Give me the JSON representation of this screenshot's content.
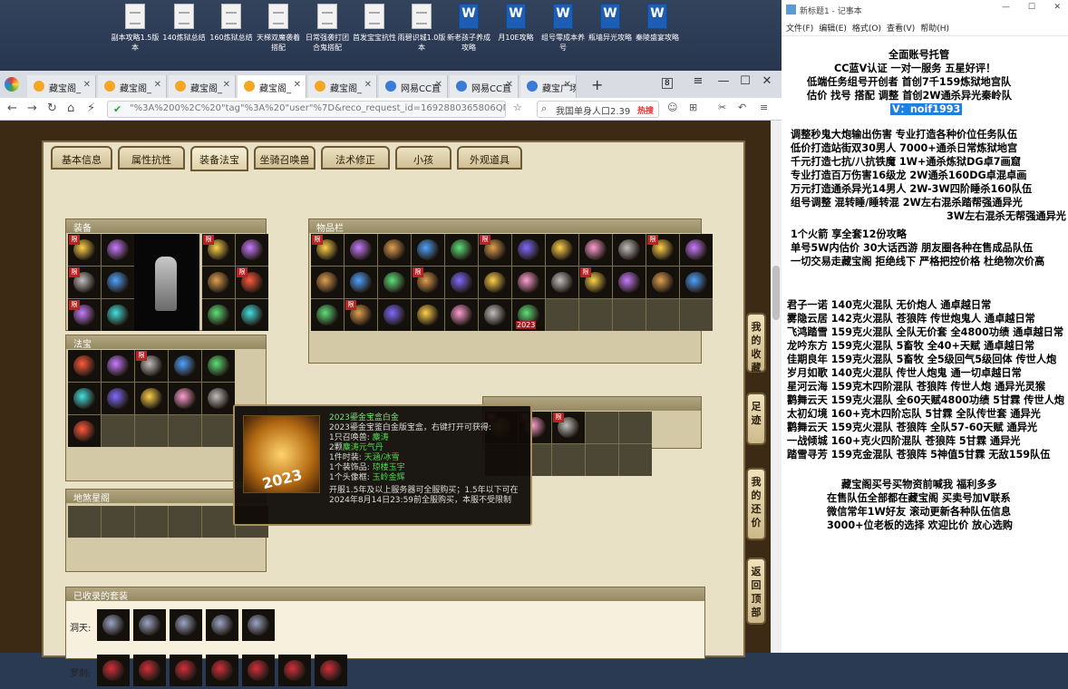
{
  "desktop": {
    "icons": [
      {
        "label": "副本攻略1.5版本",
        "type": "doc"
      },
      {
        "label": "140炼狱总结",
        "type": "doc"
      },
      {
        "label": "160炼狱总结",
        "type": "doc"
      },
      {
        "label": "天梯双魔袭着搭配",
        "type": "doc"
      },
      {
        "label": "日常强袭打团合鬼搭配",
        "type": "doc"
      },
      {
        "label": "首发宝宝抗性",
        "type": "doc"
      },
      {
        "label": "雨碧识城1.0版本",
        "type": "doc"
      },
      {
        "label": "新老孩子养成攻略",
        "type": "word"
      },
      {
        "label": "月10E攻略",
        "type": "word"
      },
      {
        "label": "组号零成本养号",
        "type": "word"
      },
      {
        "label": "瓶墙异光攻略",
        "type": "word"
      },
      {
        "label": "秦陵盛宴攻略",
        "type": "word"
      }
    ]
  },
  "browser": {
    "tabs": [
      {
        "label": "藏宝阁_",
        "icon": "orange"
      },
      {
        "label": "藏宝阁_",
        "icon": "orange"
      },
      {
        "label": "藏宝阁_",
        "icon": "orange"
      },
      {
        "label": "藏宝阁_",
        "icon": "orange",
        "active": true
      },
      {
        "label": "藏宝阁_",
        "icon": "orange"
      },
      {
        "label": "网易CC直",
        "icon": "blue"
      },
      {
        "label": "网易CC直",
        "icon": "blue"
      },
      {
        "label": "藏宝广场",
        "icon": "blue"
      }
    ],
    "new_tab": "+",
    "tab_count": "8",
    "url": "\"%3A%200%2C%20\"tag\"%3A%20\"user\"%7D&reco_request_id=1692880365806QNgJ",
    "search_text": "我国单身人口2.39",
    "hot_label": "热搜"
  },
  "game": {
    "tabs": [
      "基本信息",
      "属性抗性",
      "装备法宝",
      "坐骑召唤兽",
      "法术修正",
      "小孩",
      "外观道具"
    ],
    "active_tab": "装备法宝",
    "sections": {
      "equip": "装备",
      "items": "物品栏",
      "fabao": "法宝",
      "scene": "地煞星阁",
      "collected": "已收录的套装"
    },
    "limit_mark": "限",
    "item_badge": "2023",
    "set_rows": [
      {
        "label": "洞天:"
      },
      {
        "label": "罗刹:"
      }
    ],
    "side_buttons": [
      "我的收藏",
      "足迹",
      "我的还价",
      "返回顶部"
    ],
    "tooltip": {
      "year": "2023",
      "lines": [
        {
          "text": "2023鎏金宝盒白金",
          "color": "#7ee07e"
        },
        {
          "text": "2023鎏金宝鉴白金版宝盒，右键打开可获得:",
          "color": "#dddddd"
        },
        {
          "text": "1只召唤兽: ",
          "value": "麋涛"
        },
        {
          "text": "2颗",
          "value": "麋涛元气丹"
        },
        {
          "text": "1件时装: ",
          "value": "天涵/冰雪"
        },
        {
          "text": "1个装饰品: ",
          "value": "琼楼玉宇"
        },
        {
          "text": "1个头像框: ",
          "value": "玉岭金辉"
        },
        {
          "text": "开服1.5年及以上服务器可全服购买；1.5年以下可在",
          "color": "#dddddd"
        },
        {
          "text": "2024年8月14日23:59前全服购买，本服不受限制",
          "color": "#dddddd"
        }
      ]
    }
  },
  "notepad": {
    "title": "新标题1 - 记事本",
    "menu": [
      "文件(F)",
      "编辑(E)",
      "格式(O)",
      "查看(V)",
      "帮助(H)"
    ],
    "lines": [
      {
        "text": "全面账号托管",
        "color": "#000000"
      },
      {
        "text": "CC蓝V认证 一对一服务 五星好评！",
        "color": "#000000"
      },
      {
        "text": "低端任务组号开创者          首创7千159炼狱地宫队",
        "color": "#000000"
      },
      {
        "text": "估价 找号 搭配 调整          首创2W通杀异光秦岭队",
        "color": "#000000"
      },
      {
        "text": "V：noif1993",
        "color": "#ffffff",
        "highlight": true
      },
      {
        "text": "调整秒鬼大炮输出伤害          专业打造各种价位任务队伍",
        "color": "#000000"
      },
      {
        "text": "低价打造站街双30男人          7000+通杀日常炼狱地宫",
        "color": "#000000"
      },
      {
        "text": "千元打造七抗/八抗铁魔          1W+通杀炼狱DG卓7画窟",
        "color": "#000000"
      },
      {
        "text": "专业打造百万伤害16级龙          2W通杀160DG卓混卓画",
        "color": "#000000"
      },
      {
        "text": "万元打造通杀异光14男人          2W-3W四阶睡杀160队伍",
        "color": "#000000"
      },
      {
        "text": "组号调整 混转睡/睡转混          2W左右混杀踏帮强通异光",
        "color": "#000000"
      },
      {
        "text": "3W左右混杀无帮强通异光",
        "color": "#000000"
      },
      {
        "text": "1个火箭 享全套12份攻略",
        "color": "#000000"
      },
      {
        "text": "单号5W内估价 30大话西游          朋友圈各种在售成品队伍",
        "color": "#000000"
      },
      {
        "text": "一切交易走藏宝阁 拒绝线下          严格把控价格 杜绝物次价高",
        "color": "#000000"
      },
      {
        "text": "君子一诺 140克火混队 无价炮人 通卓越日常",
        "color": "#000000"
      },
      {
        "text": "雾隐云居 142克火混队 苍狼阵 传世炮鬼人 通卓越日常",
        "color": "#000000"
      },
      {
        "text": "飞鸿踏雪 159克火混队 全队无价套 全4800功绩 通卓越日常",
        "color": "#000000"
      },
      {
        "text": "龙吟东方 159克火混队 5畜牧 全40+天赋 通卓越日常",
        "color": "#000000"
      },
      {
        "text": "佳期良年 159克火混队 5畜牧 全5级回气5级回体 传世人炮",
        "color": "#000000"
      },
      {
        "text": "岁月如歌 140克火混队 传世人炮鬼 通一切卓越日常",
        "color": "#000000"
      },
      {
        "text": "星河云海 159克木四阶混队 苍狼阵 传世人炮 通异光灵猴",
        "color": "#000000"
      },
      {
        "text": "鹳舞云天 159克火混队 全60天赋4800功绩 5甘霖 传世人炮",
        "color": "#000000"
      },
      {
        "text": "太初幻境 160+克木四阶忘队 5甘霖 全队传世套 通异光",
        "color": "#000000"
      },
      {
        "text": "鹳舞云天 159克火混队 苍狼阵 全队57-60天赋 通异光",
        "color": "#000000"
      },
      {
        "text": "一战倾城 160+克火四阶混队 苍狼阵 5甘霖 通异光",
        "color": "#000000"
      },
      {
        "text": "踏雪寻芳 159克金混队 苍狼阵 5神值5甘霖 无敌159队伍",
        "color": "#000000"
      },
      {
        "text": "藏宝阁买号买物资前喊我 福利多多",
        "color": "#000000"
      },
      {
        "text": "在售队伍全部都在藏宝阁 买卖号加V联系",
        "color": "#000000"
      },
      {
        "text": "微信常年1W好友 滚动更新各种队伍信息",
        "color": "#000000"
      },
      {
        "text": "3000+位老板的选择 欢迎比价 放心选购",
        "color": "#000000"
      }
    ]
  }
}
